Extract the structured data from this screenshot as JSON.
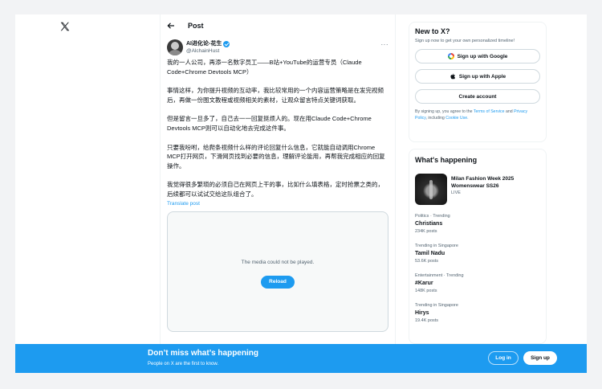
{
  "header": {
    "title": "Post"
  },
  "post": {
    "author_name": "AI进化论-花生",
    "author_handle": "@AlchainHust",
    "more_label": "···",
    "paragraphs": [
      "我的一人公司，再添一名数字员工——B站+YouTube的运营专员（Claude Code+Chrome Devtools MCP）",
      "事情这样，为你提升视频的互动率，我比较常用的一个内容运营策略是在发完视频后，再做一份图文教程或视频相关的素材，让观众留言特点关键词获取。",
      "但是留言一旦多了，自己去一一回复挺烦人的。现在用Claude Code+Chrome Devtools MCP则可以自动化地去完成这件事。",
      "只要我吩咐，给爬条视频什么样的评论回复什么信息，它就能自动调用Chrome MCP打开网页，下滑网页找到必要的信息，理解评论能用，再帮我完成相应的回复操作。",
      "我觉得很多繁琐的必须自己在网页上干的事，比如什么填表格，定时抢票之类的，后续都可以试试交给这队组合了。"
    ],
    "translate_label": "Translate post",
    "media_message": "The media could not be played.",
    "reload_label": "Reload"
  },
  "sidebar_signup": {
    "title": "New to X?",
    "subtitle": "Sign up now to get your own personalized timeline!",
    "google_label": "Sign up with Google",
    "apple_label": "Sign up with Apple",
    "create_label": "Create account",
    "legal_prefix": "By signing up, you agree to the",
    "terms_label": "Terms of Service",
    "and_label": "and",
    "privacy_label": "Privacy Policy",
    "including_label": ", including",
    "cookie_label": "Cookie Use."
  },
  "trending": {
    "title": "What's happening",
    "feature": {
      "title": "Milan Fashion Week 2025 Womenswear SS26",
      "status": "LIVE"
    },
    "items": [
      {
        "meta": "Politics · Trending",
        "name": "Christians",
        "posts": "234K posts"
      },
      {
        "meta": "Trending in Singapore",
        "name": "Tamil Nadu",
        "posts": "53.6K posts"
      },
      {
        "meta": "Entertainment · Trending",
        "name": "#Karur",
        "posts": "148K posts"
      },
      {
        "meta": "Trending in Singapore",
        "name": "Hirys",
        "posts": "19.4K posts"
      }
    ]
  },
  "banner": {
    "title": "Don’t miss what’s happening",
    "subtitle": "People on X are the first to know.",
    "login_label": "Log in",
    "signup_label": "Sign up"
  },
  "colors": {
    "accent": "#1d9bf0",
    "text": "#0f1419",
    "muted": "#536471"
  }
}
